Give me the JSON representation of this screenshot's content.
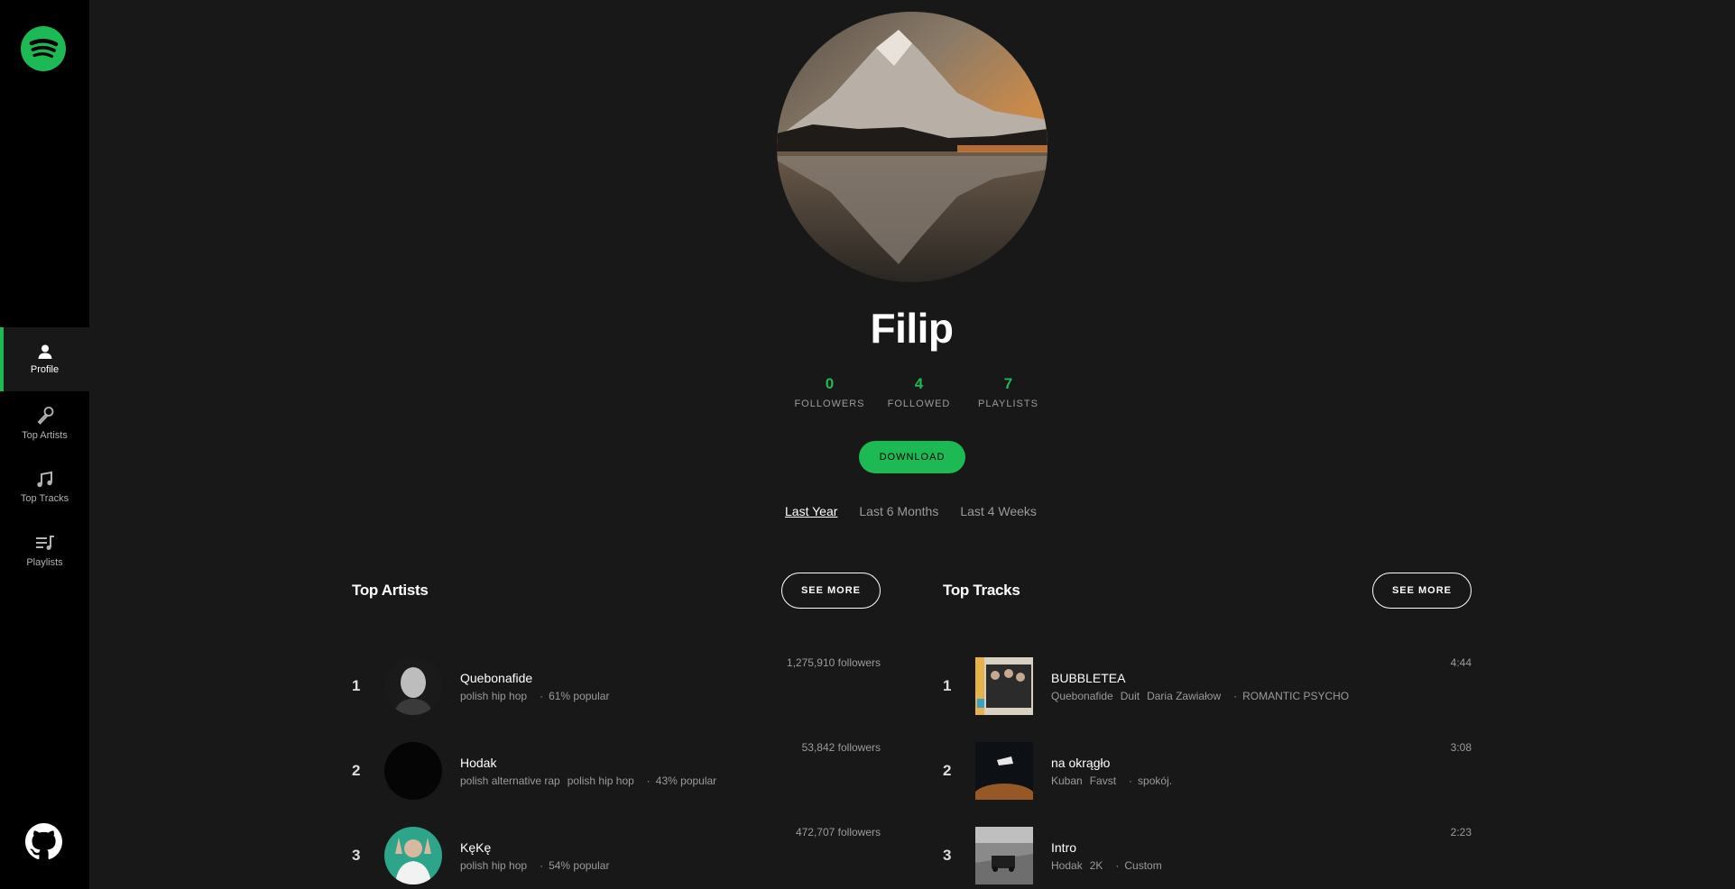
{
  "sidebar": {
    "logo_icon": "spotify-logo-icon",
    "items": [
      {
        "label": "Profile",
        "icon": "user-icon"
      },
      {
        "label": "Top Artists",
        "icon": "microphone-icon"
      },
      {
        "label": "Top Tracks",
        "icon": "music-note-icon"
      },
      {
        "label": "Playlists",
        "icon": "playlist-icon"
      }
    ],
    "github_icon": "github-icon"
  },
  "profile": {
    "name": "Filip",
    "stats": [
      {
        "value": "0",
        "label": "FOLLOWERS"
      },
      {
        "value": "4",
        "label": "FOLLOWED"
      },
      {
        "value": "7",
        "label": "PLAYLISTS"
      }
    ],
    "download_label": "DOWNLOAD",
    "ranges": [
      {
        "label": "Last Year",
        "active": true
      },
      {
        "label": "Last 6 Months",
        "active": false
      },
      {
        "label": "Last 4 Weeks",
        "active": false
      }
    ]
  },
  "top_artists": {
    "title": "Top Artists",
    "see_more": "SEE MORE",
    "items": [
      {
        "rank": "1",
        "name": "Quebonafide",
        "genres": [
          "polish hip hop"
        ],
        "popularity": "61% popular",
        "followers": "1,275,910 followers"
      },
      {
        "rank": "2",
        "name": "Hodak",
        "genres": [
          "polish alternative rap",
          "polish hip hop"
        ],
        "popularity": "43% popular",
        "followers": "53,842 followers"
      },
      {
        "rank": "3",
        "name": "KęKę",
        "genres": [
          "polish hip hop"
        ],
        "popularity": "54% popular",
        "followers": "472,707 followers"
      }
    ]
  },
  "top_tracks": {
    "title": "Top Tracks",
    "see_more": "SEE MORE",
    "items": [
      {
        "rank": "1",
        "name": "BUBBLETEA",
        "artists": [
          "Quebonafide",
          "Duit",
          "Daria Zawiałow"
        ],
        "album": "ROMANTIC PSYCHO",
        "duration": "4:44"
      },
      {
        "rank": "2",
        "name": "na okrągło",
        "artists": [
          "Kuban",
          "Favst"
        ],
        "album": "spokój.",
        "duration": "3:08"
      },
      {
        "rank": "3",
        "name": "Intro",
        "artists": [
          "Hodak",
          "2K"
        ],
        "album": "Custom",
        "duration": "2:23"
      }
    ]
  },
  "colors": {
    "accent": "#1db954",
    "background": "#181818",
    "sidebar": "#000000"
  }
}
